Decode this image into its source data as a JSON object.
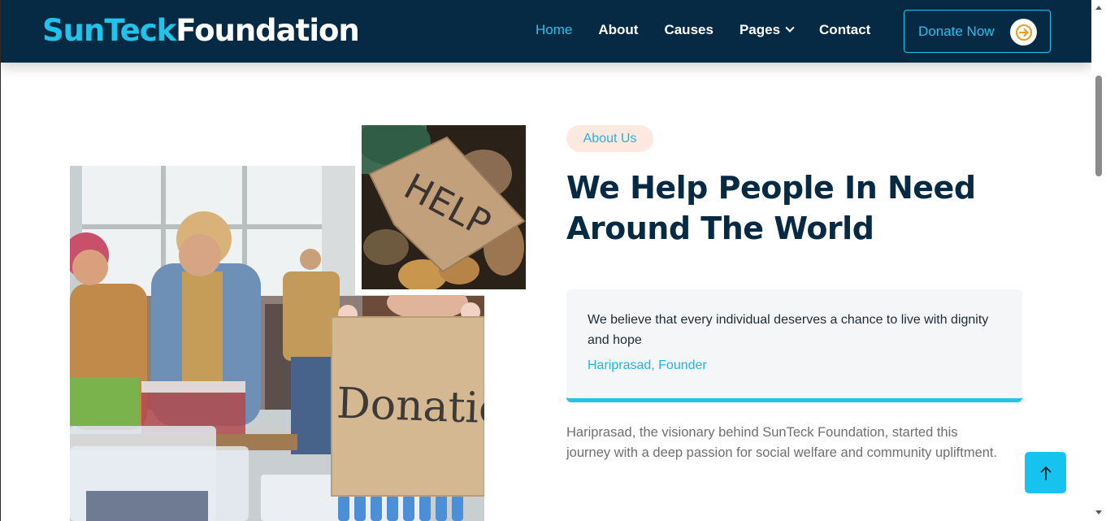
{
  "header": {
    "logo_part1": "SunTeck",
    "logo_part2": "Foundation",
    "nav": [
      {
        "label": "Home"
      },
      {
        "label": "About"
      },
      {
        "label": "Causes"
      },
      {
        "label": "Pages"
      },
      {
        "label": "Contact"
      }
    ],
    "donate_label": "Donate Now"
  },
  "about": {
    "badge": "About Us",
    "heading_line1": "We Help People In Need",
    "heading_line2": "Around The World",
    "quote": "We believe that every individual deserves a chance to live with dignity and hope",
    "quote_author": "Hariprasad, Founder",
    "paragraph": "Hariprasad, the visionary behind SunTeck Foundation, started this journey with a deep passion for social welfare and community upliftment.",
    "images": {
      "help_sign_text": "HELP",
      "donation_sign_text": "Donation"
    }
  },
  "colors": {
    "header_bg": "#062a44",
    "accent": "#22c3eb",
    "heading": "#062a44",
    "badge_bg": "#fde9df",
    "arrow_orange": "#f39a1e"
  },
  "icons": {
    "donate_arrow": "arrow-right-icon",
    "back_to_top": "arrow-up-icon",
    "pages_dropdown": "chevron-down-icon"
  }
}
